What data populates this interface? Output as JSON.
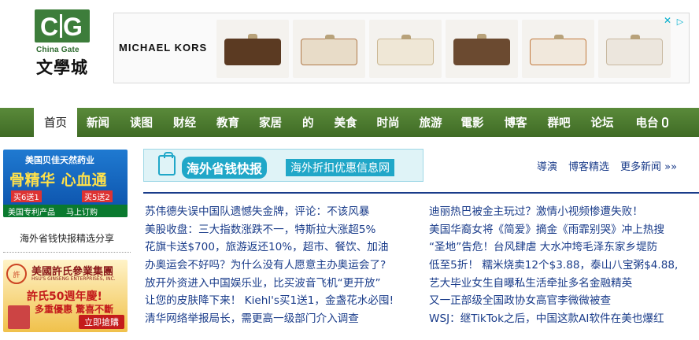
{
  "site": {
    "logo_subtitle": "China Gate",
    "logo_chinese": "文學城",
    "logo_letters": "CG"
  },
  "ad_banner": {
    "brand": "MICHAEL KORS",
    "colors": [
      "#5b3a22",
      "#e8dcc8",
      "#efe7d6",
      "#6b4a30",
      "#f1e8dc",
      "#ece6dd"
    ]
  },
  "nav": {
    "items": [
      {
        "label": "首页",
        "active": true
      },
      {
        "label": "新闻"
      },
      {
        "label": "读图"
      },
      {
        "label": "财经"
      },
      {
        "label": "教育"
      },
      {
        "label": "家居"
      },
      {
        "label": "的"
      },
      {
        "label": "美食"
      },
      {
        "label": "时尚"
      },
      {
        "label": "旅游"
      },
      {
        "label": "電影"
      },
      {
        "label": "博客"
      },
      {
        "label": "群吧"
      },
      {
        "label": "论坛"
      },
      {
        "label": "电台"
      }
    ]
  },
  "left_ad1": {
    "title": "美国贝佳天然药业",
    "main": "骨精华 心血通",
    "offer1": "买6送1",
    "offer2": "买5送2",
    "bottom1": "美国专利产品",
    "bottom2": "马上订购"
  },
  "left_link": "海外省钱快报精选分享",
  "left_ad2": {
    "title": "美國許氏參業集團",
    "subtitle": "HSU'S GINSENG ENTERPRISES, INC.",
    "seal": "許",
    "main": "許氏50週年慶!",
    "deal": "多重優惠 驚喜不斷",
    "button": "立即搶購"
  },
  "center_banner": {
    "title": "海外省钱快报",
    "desc": "海外折扣优惠信息网"
  },
  "right_links": {
    "link1": "導演",
    "link2": "博客精选",
    "link3": "更多新闻 »»"
  },
  "headlines_left": [
    "苏伟德失误中国队遗憾失金牌，评论：不该风暴",
    "美股收盘：三大指数涨跌不一，特斯拉大涨超5%",
    "花旗卡送$700，旅游返还10%，超市、餐饮、加油",
    "办奥运会不好吗？为什么没有人愿意主办奥运会了?",
    "放开外资进入中国娱乐业，比买波音飞机“更开放”",
    "让您的皮肤降下来！ Kiehl's买1送1，金盏花水必囤!",
    "清华网络举报局长，需更高一级部门介入调查"
  ],
  "headlines_right": [
    "迪丽热巴被金主玩过？激情小视频惨遭失败！",
    "美国华裔女将《简爱》摘金《雨霏别哭》冲上热搜",
    "“圣地”告危！台风肆虐 大水冲垮毛泽东家乡堤防",
    "低至5折！ 糯米烧卖12个$3.88，泰山八宝粥$4.88,",
    "艺大毕业女生自曝私生活牵扯多名金融精英",
    "又一正部级全国政协女高官李微微被查",
    "WSJ：继TikTok之后，中国这款AI软件在美也爆红"
  ]
}
